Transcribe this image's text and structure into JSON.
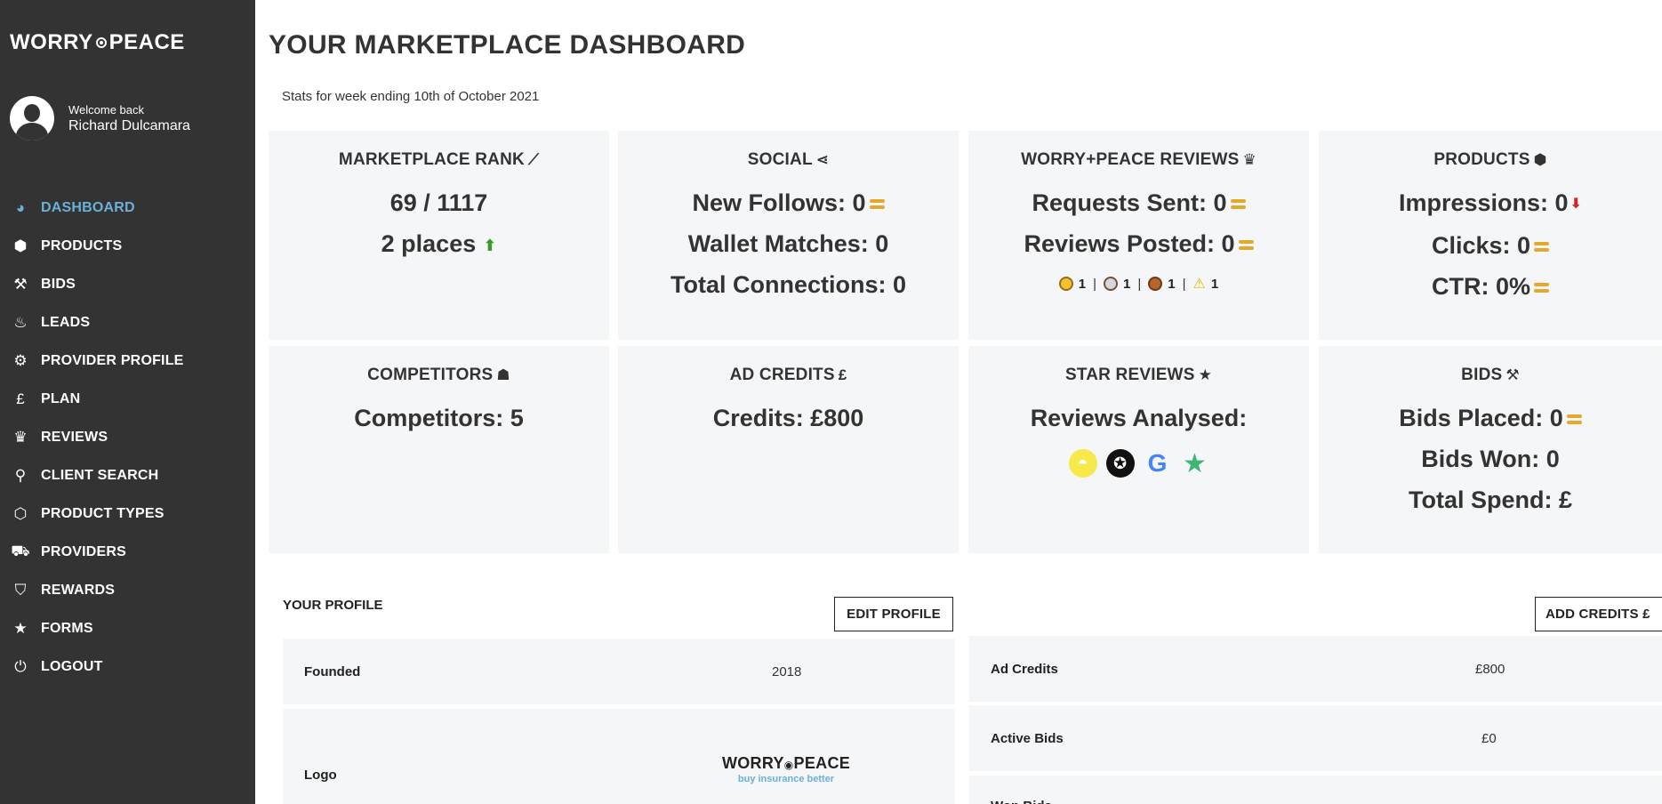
{
  "brand": {
    "logo_left": "WORRY",
    "logo_right": "PEACE"
  },
  "user": {
    "welcome": "Welcome back",
    "name": "Richard Dulcamara"
  },
  "sidebar": {
    "items": [
      {
        "label": "DASHBOARD",
        "icon": "pie-chart-icon",
        "active": true
      },
      {
        "label": "PRODUCTS",
        "icon": "cube-icon"
      },
      {
        "label": "BIDS",
        "icon": "gavel-icon"
      },
      {
        "label": "LEADS",
        "icon": "fire-icon"
      },
      {
        "label": "PROVIDER PROFILE",
        "icon": "gear-icon"
      },
      {
        "label": "PLAN",
        "icon": "pound-icon"
      },
      {
        "label": "REVIEWS",
        "icon": "trophy-icon"
      },
      {
        "label": "CLIENT SEARCH",
        "icon": "search-icon"
      },
      {
        "label": "PRODUCT TYPES",
        "icon": "cubes-icon"
      },
      {
        "label": "PROVIDERS",
        "icon": "cart-icon"
      },
      {
        "label": "REWARDS",
        "icon": "tags-icon"
      },
      {
        "label": "FORMS",
        "icon": "star-icon"
      },
      {
        "label": "LOGOUT",
        "icon": "power-icon"
      }
    ]
  },
  "header": {
    "title": "YOUR MARKETPLACE DASHBOARD",
    "subtitle": "Stats for week ending 10th of October 2021"
  },
  "cards": {
    "rank": {
      "title": "MARKETPLACE RANK",
      "value": "69 / 1117",
      "change": "2 places"
    },
    "social": {
      "title": "SOCIAL",
      "follows": "New Follows: 0",
      "wallet": "Wallet Matches: 0",
      "connections": "Total Connections: 0"
    },
    "reviews": {
      "title": "WORRY+PEACE REVIEWS",
      "requests": "Requests Sent: 0",
      "posted": "Reviews Posted: 0",
      "gold": "1",
      "silver": "1",
      "bronze": "1",
      "warning": "1"
    },
    "products": {
      "title": "PRODUCTS",
      "impressions": "Impressions: 0",
      "clicks": "Clicks: 0",
      "ctr": "CTR: 0%"
    },
    "competitors": {
      "title": "COMPETITORS",
      "value": "Competitors: 5"
    },
    "adcredits": {
      "title": "AD CREDITS",
      "title_symbol": "£",
      "value": "Credits: £800"
    },
    "star": {
      "title": "STAR REVIEWS",
      "value": "Reviews Analysed:"
    },
    "bids": {
      "title": "BIDS",
      "placed": "Bids Placed: 0",
      "won": "Bids Won: 0",
      "spend": "Total Spend: £"
    }
  },
  "profile": {
    "label": "YOUR PROFILE",
    "edit_button": "EDIT PROFILE",
    "add_credits_button": "ADD CREDITS £",
    "left_rows": [
      {
        "key": "Founded",
        "value": "2018"
      },
      {
        "key": "Logo",
        "logo_text_left": "WORRY",
        "logo_text_right": "PEACE",
        "logo_tagline": "buy insurance better"
      }
    ],
    "right_rows": [
      {
        "key": "Ad Credits",
        "value": "£800"
      },
      {
        "key": "Active Bids",
        "value": "£0"
      },
      {
        "key": "Won Bids"
      }
    ]
  },
  "colors": {
    "sidebar_bg": "#333333",
    "active": "#6ab0d9",
    "card_bg": "#f5f6f8",
    "equal": "#e6a82a",
    "up": "#3a9b26",
    "down": "#d42323"
  }
}
